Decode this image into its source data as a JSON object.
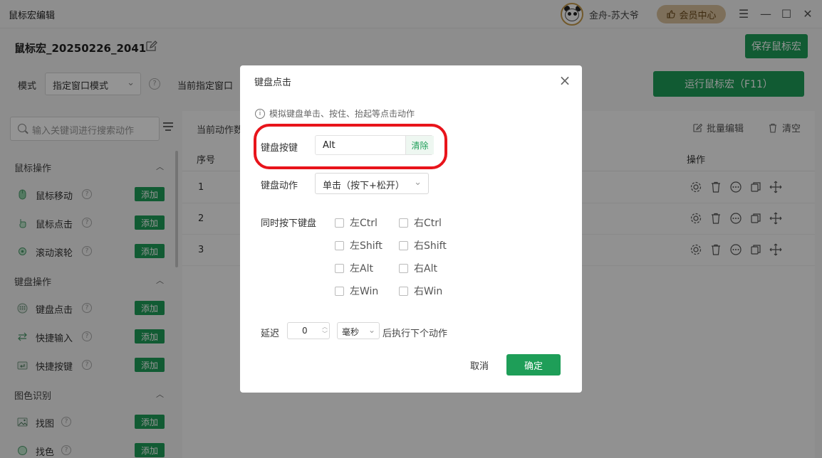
{
  "app": {
    "title": "鼠标宏编辑",
    "username": "金舟-苏大爷",
    "vip_label": "会员中心",
    "window_controls": [
      "menu-icon",
      "minimize-icon",
      "maximize-icon",
      "close-icon"
    ]
  },
  "header": {
    "macro_name": "鼠标宏_20250226_2041",
    "save_label": "保存鼠标宏",
    "mode_label": "模式",
    "mode_value": "指定窗口模式",
    "current_window_label": "当前指定窗口",
    "run_label": "运行鼠标宏（F11）"
  },
  "sidebar": {
    "search_placeholder": "输入关键词进行搜索动作",
    "add_label": "添加",
    "groups": [
      {
        "title": "鼠标操作",
        "items": [
          {
            "label": "鼠标移动",
            "icon": "mouse-move-icon"
          },
          {
            "label": "鼠标点击",
            "icon": "mouse-click-icon"
          },
          {
            "label": "滚动滚轮",
            "icon": "scroll-wheel-icon"
          }
        ]
      },
      {
        "title": "键盘操作",
        "items": [
          {
            "label": "键盘点击",
            "icon": "keyboard-icon"
          },
          {
            "label": "快捷输入",
            "icon": "quick-input-icon"
          },
          {
            "label": "快捷按键",
            "icon": "shortcut-key-icon"
          }
        ]
      },
      {
        "title": "图色识别",
        "items": [
          {
            "label": "找图",
            "icon": "image-icon"
          },
          {
            "label": "找色",
            "icon": "color-icon"
          }
        ]
      }
    ]
  },
  "main": {
    "list_label": "当前动作数",
    "bulk_edit": "批量编辑",
    "clear_all": "清空",
    "columns": {
      "seq": "序号",
      "ops": "操作"
    },
    "rows": [
      "1",
      "2",
      "3"
    ],
    "row_ops": [
      "settings-icon",
      "delete-icon",
      "more-icon",
      "copy-icon",
      "move-icon"
    ]
  },
  "dialog": {
    "title": "键盘点击",
    "info": "模拟键盘单击、按住、抬起等点击动作",
    "key_label": "键盘按键",
    "key_value": "Alt",
    "key_clear": "清除",
    "action_label": "键盘动作",
    "action_value": "单击（按下+松开）",
    "modifiers_label": "同时按下键盘",
    "modifiers": [
      {
        "label": "左Ctrl",
        "checked": false
      },
      {
        "label": "右Ctrl",
        "checked": false
      },
      {
        "label": "左Shift",
        "checked": false
      },
      {
        "label": "右Shift",
        "checked": false
      },
      {
        "label": "左Alt",
        "checked": false
      },
      {
        "label": "右Alt",
        "checked": false
      },
      {
        "label": "左Win",
        "checked": false
      },
      {
        "label": "右Win",
        "checked": false
      }
    ],
    "delay_label": "延迟",
    "delay_value": "0",
    "delay_unit": "毫秒",
    "after_text": "后执行下个动作",
    "cancel_label": "取消",
    "ok_label": "确定",
    "highlight_color": "#e8141b",
    "accent_color": "#1e9e58"
  }
}
